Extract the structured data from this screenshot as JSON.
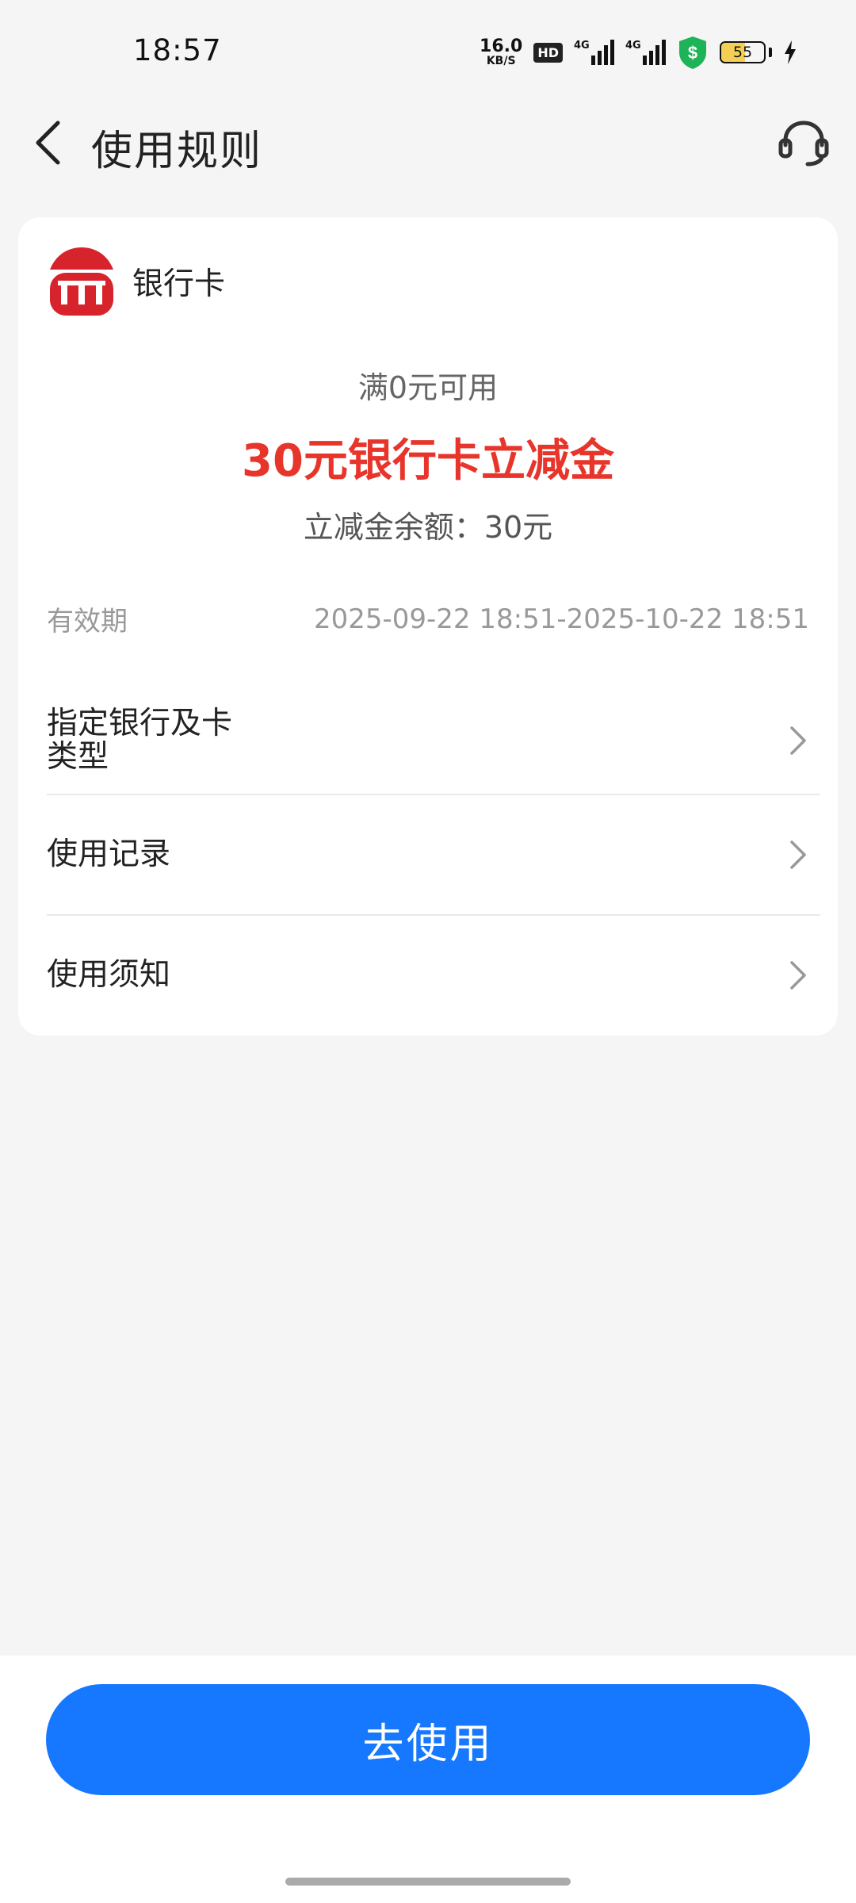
{
  "status_bar": {
    "time": "18:57",
    "net_speed_value": "16.0",
    "net_speed_unit": "KB/S",
    "hd_label": "HD",
    "signal1_tag": "4G",
    "signal2_tag": "4G",
    "battery_level": "55",
    "battery_percent": 55,
    "icons": [
      "hd-icon",
      "signal-icon",
      "signal-icon",
      "security-shield-icon",
      "battery-icon",
      "charging-bolt-icon"
    ],
    "colors": {
      "shield": "#1fb358",
      "battery_fill": "#f5cf55"
    }
  },
  "header": {
    "title": "使用规则",
    "back_icon": "chevron-left-icon",
    "service_icon": "headset-icon"
  },
  "card": {
    "logo_icon": "bank-logo-icon",
    "card_type": "银行卡",
    "threshold": "满0元可用",
    "coupon_name": "30元银行卡立减金",
    "balance": "立减金余额：30元",
    "validity_label": "有效期",
    "validity_value": "2025-09-22 18:51-2025-10-22 18:51",
    "menu": [
      {
        "label": "指定银行及卡类型"
      },
      {
        "label": "使用记录"
      },
      {
        "label": "使用须知"
      }
    ],
    "colors": {
      "highlight": "#e8352b",
      "logo": "#d7242c"
    }
  },
  "footer": {
    "button_label": "去使用",
    "button_color": "#1677ff"
  }
}
